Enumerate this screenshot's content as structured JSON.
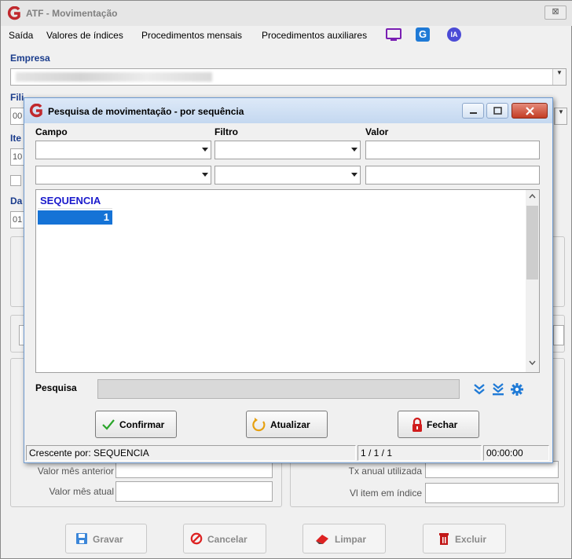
{
  "app": {
    "title": "ATF - Movimentação",
    "close_glyph": "⊠"
  },
  "menu": {
    "items": [
      "Saída",
      "Valores de índices",
      "Procedimentos mensais",
      "Procedimentos auxiliares"
    ],
    "icons": [
      "monitor-icon",
      "g-app-icon",
      "ia-icon"
    ],
    "ia_label": "IA",
    "g_label": "G"
  },
  "form": {
    "empresa_label": "Empresa",
    "filial_label_partial": "Fili",
    "filial_value_partial": "00",
    "item_label_partial": "Ite",
    "item_value_partial": "10",
    "data_label_partial": "Da",
    "data_value_partial": "01",
    "valor_mes_anterior_label": "Valor mês anterior",
    "valor_mes_atual_label": "Valor mês atual",
    "tx_anual_label": "Tx anual utilizada",
    "vl_item_indice_label": "Vl item em índice"
  },
  "bottom_buttons": {
    "gravar": "Gravar",
    "cancelar": "Cancelar",
    "limpar": "Limpar",
    "excluir": "Excluir"
  },
  "dialog": {
    "title": "Pesquisa de movimentação - por sequência",
    "col_campo": "Campo",
    "col_filtro": "Filtro",
    "col_valor": "Valor",
    "grid": {
      "columns": [
        "SEQUENCIA"
      ],
      "rows": [
        [
          "1"
        ]
      ]
    },
    "pesquisa_label": "Pesquisa",
    "pesquisa_value": "",
    "confirmar": "Confirmar",
    "atualizar": "Atualizar",
    "fechar": "Fechar",
    "status": {
      "order": "Crescente por: SEQUENCIA",
      "page": "1 / 1 / 1",
      "time": "00:00:00"
    }
  },
  "colors": {
    "label_blue": "#1a3c8c",
    "grid_select": "#1573d6",
    "brand_red": "#c0282d",
    "icon_blue": "#1f7ad6"
  }
}
